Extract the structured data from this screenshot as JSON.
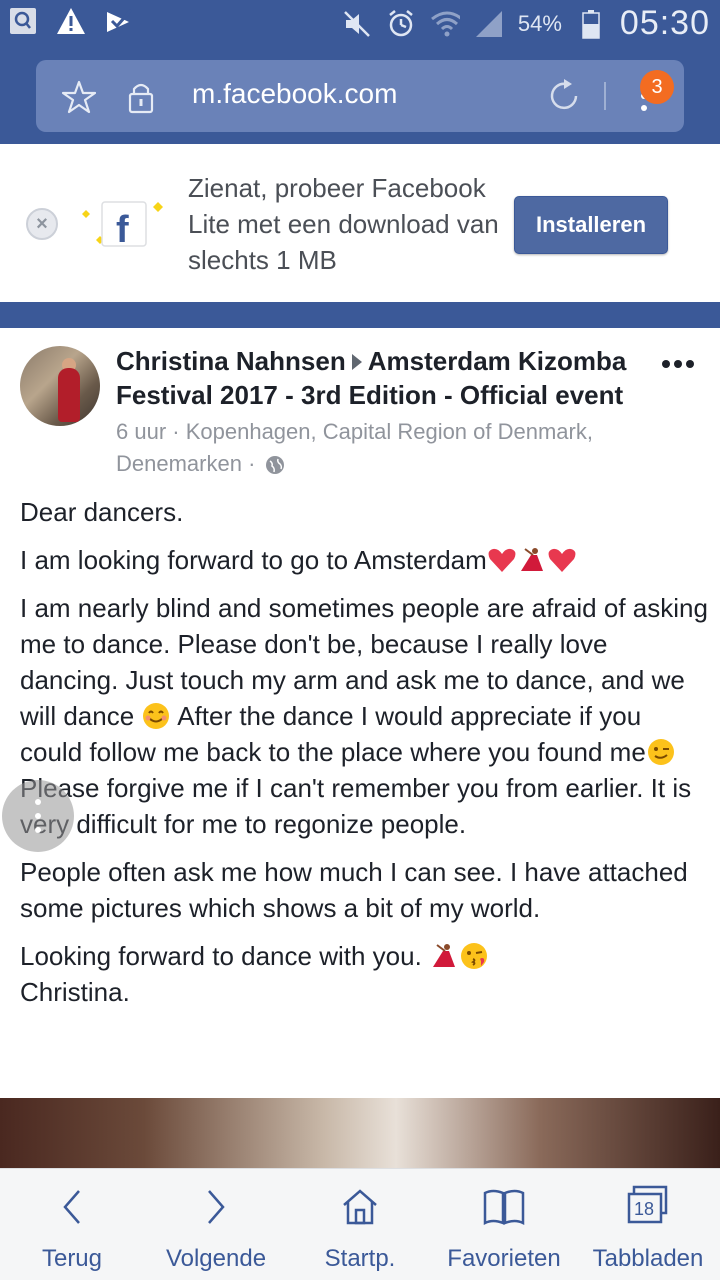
{
  "status_bar": {
    "battery": "54%",
    "time": "05:30",
    "icons": [
      "screen-capture-icon",
      "warning-icon",
      "check-icon",
      "mute-icon",
      "alarm-icon",
      "wifi-icon",
      "signal-icon",
      "battery-icon"
    ]
  },
  "browser": {
    "url": "m.facebook.com",
    "menu_badge": "3"
  },
  "lite_banner": {
    "text": "Zienat, probeer Facebook Lite met een download van slechts 1 MB",
    "install_label": "Installeren"
  },
  "post": {
    "author": "Christina Nahnsen",
    "target": "Amsterdam Kizomba Festival 2017 - 3rd Edition - Official event",
    "time": "6 uur",
    "location": "Kopenhagen, Capital Region of Denmark, Denemarken",
    "paragraphs": {
      "p1": "Dear dancers.",
      "p2": "I am looking forward to go to Amsterdam",
      "p3": "I am nearly blind and sometimes people are afraid of asking me to dance. Please don't be, because I really love dancing. Just touch my arm and ask me to dance, and we will dance",
      "p3b": "After the dance I would appreciate if you could follow me back to the place where you found me",
      "p3c": "Please forgive me if I can't remember you from earlier. It is very difficult for me to regonize people.",
      "p4": "People often ask me how much I can see. I have attached some pictures which shows a bit of my world.",
      "p5": "Looking forward to dance with you.",
      "p5b": "Christina."
    }
  },
  "bottom_nav": {
    "back": "Terug",
    "forward": "Volgende",
    "home": "Startp.",
    "favorites": "Favorieten",
    "tabs": "Tabbladen",
    "tab_count": "18"
  },
  "colors": {
    "facebook_blue": "#3b5998",
    "badge_orange": "#f36c21"
  }
}
